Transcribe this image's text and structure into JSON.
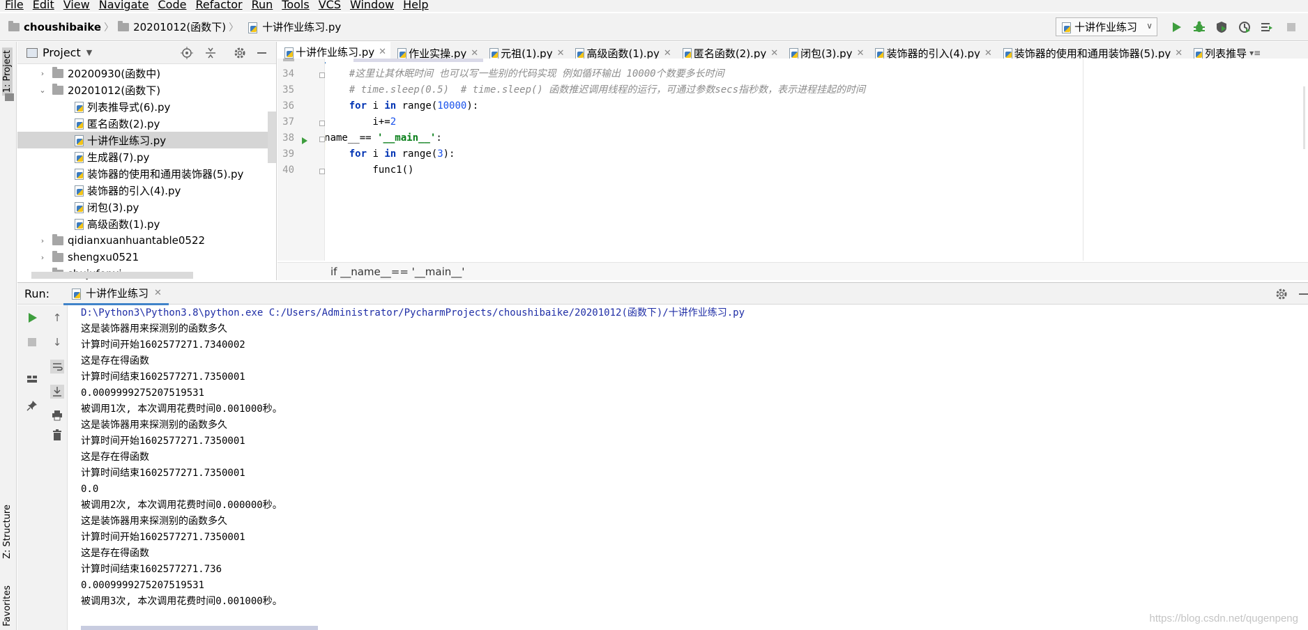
{
  "menu": [
    "File",
    "Edit",
    "View",
    "Navigate",
    "Code",
    "Refactor",
    "Run",
    "Tools",
    "VCS",
    "Window",
    "Help"
  ],
  "nav": {
    "project": "choushibaike",
    "folder": "20201012(函数下)",
    "file": "十讲作业练习.py",
    "run_config": "十讲作业练习"
  },
  "project_panel": {
    "title": "Project",
    "tree": [
      {
        "label": "20200930(函数中)",
        "type": "folder",
        "level": 1,
        "expanded": false
      },
      {
        "label": "20201012(函数下)",
        "type": "folder",
        "level": 1,
        "expanded": true
      },
      {
        "label": "列表推导式(6).py",
        "type": "file",
        "level": 2
      },
      {
        "label": "匿名函数(2).py",
        "type": "file",
        "level": 2
      },
      {
        "label": "十讲作业练习.py",
        "type": "file",
        "level": 2,
        "selected": true
      },
      {
        "label": "生成器(7).py",
        "type": "file",
        "level": 2
      },
      {
        "label": "装饰器的使用和通用装饰器(5).py",
        "type": "file",
        "level": 2
      },
      {
        "label": "装饰器的引入(4).py",
        "type": "file",
        "level": 2
      },
      {
        "label": "闭包(3).py",
        "type": "file",
        "level": 2
      },
      {
        "label": "高级函数(1).py",
        "type": "file",
        "level": 2
      },
      {
        "label": "qidianxuanhuantable0522",
        "type": "folder",
        "level": 1,
        "expanded": false
      },
      {
        "label": "shengxu0521",
        "type": "folder",
        "level": 1,
        "expanded": false
      },
      {
        "label": "shujufenxi",
        "type": "folder",
        "level": 1,
        "expanded": false
      }
    ]
  },
  "editor": {
    "tabs": [
      "十讲作业练习.py",
      "作业实操.py",
      "元祖(1).py",
      "高级函数(1).py",
      "匿名函数(2).py",
      "闭包(3).py",
      "装饰器的引入(4).py",
      "装饰器的使用和通用装饰器(5).py",
      "列表推导"
    ],
    "line_numbers": [
      "34",
      "35",
      "36",
      "37",
      "38",
      "39",
      "40"
    ],
    "code": {
      "l34": "    #这里让其休眠时间 也可以写一些别的代码实现 例如循环输出 10000个数要多长时间",
      "l35": "    # time.sleep(0.5)  # time.sleep() 函数推迟调用线程的运行，可通过参数secs指秒数，表示进程挂起的时间",
      "l36_kw": "for",
      "l36_a": " i ",
      "l36_in": "in",
      "l36_b": " range(",
      "l36_num": "10000",
      "l36_c": "):",
      "l37_a": "        i+=",
      "l37_num": "2",
      "l38_kw": "if",
      "l38_a": " __name__== ",
      "l38_str": "'__main__'",
      "l38_b": ":",
      "l39_kw": "for",
      "l39_a": " i ",
      "l39_in": "in",
      "l39_b": " range(",
      "l39_num": "3",
      "l39_c": "):",
      "l40": "        func1()"
    },
    "breadcrumb": "if __name__== '__main__'"
  },
  "run": {
    "label": "Run:",
    "tab": "十讲作业练习",
    "output": [
      "D:\\Python3\\Python3.8\\python.exe C:/Users/Administrator/PycharmProjects/choushibaike/20201012(函数下)/十讲作业练习.py",
      "这是装饰器用来探测别的函数多久",
      "计算时间开始1602577271.7340002",
      "这是存在得函数",
      "计算时间结束1602577271.7350001",
      "0.0009999275207519531",
      "被调用1次, 本次调用花费时间0.001000秒。",
      "这是装饰器用来探测别的函数多久",
      "计算时间开始1602577271.7350001",
      "这是存在得函数",
      "计算时间结束1602577271.7350001",
      "0.0",
      "被调用2次, 本次调用花费时间0.000000秒。",
      "这是装饰器用来探测别的函数多久",
      "计算时间开始1602577271.7350001",
      "这是存在得函数",
      "计算时间结束1602577271.736",
      "0.0009999275207519531",
      "被调用3次, 本次调用花费时间0.001000秒。"
    ]
  },
  "side_tabs": {
    "project": "1: Project",
    "structure": "Z: Structure",
    "favorites": "Favorites"
  },
  "watermark": "https://blog.csdn.net/qugenpeng"
}
